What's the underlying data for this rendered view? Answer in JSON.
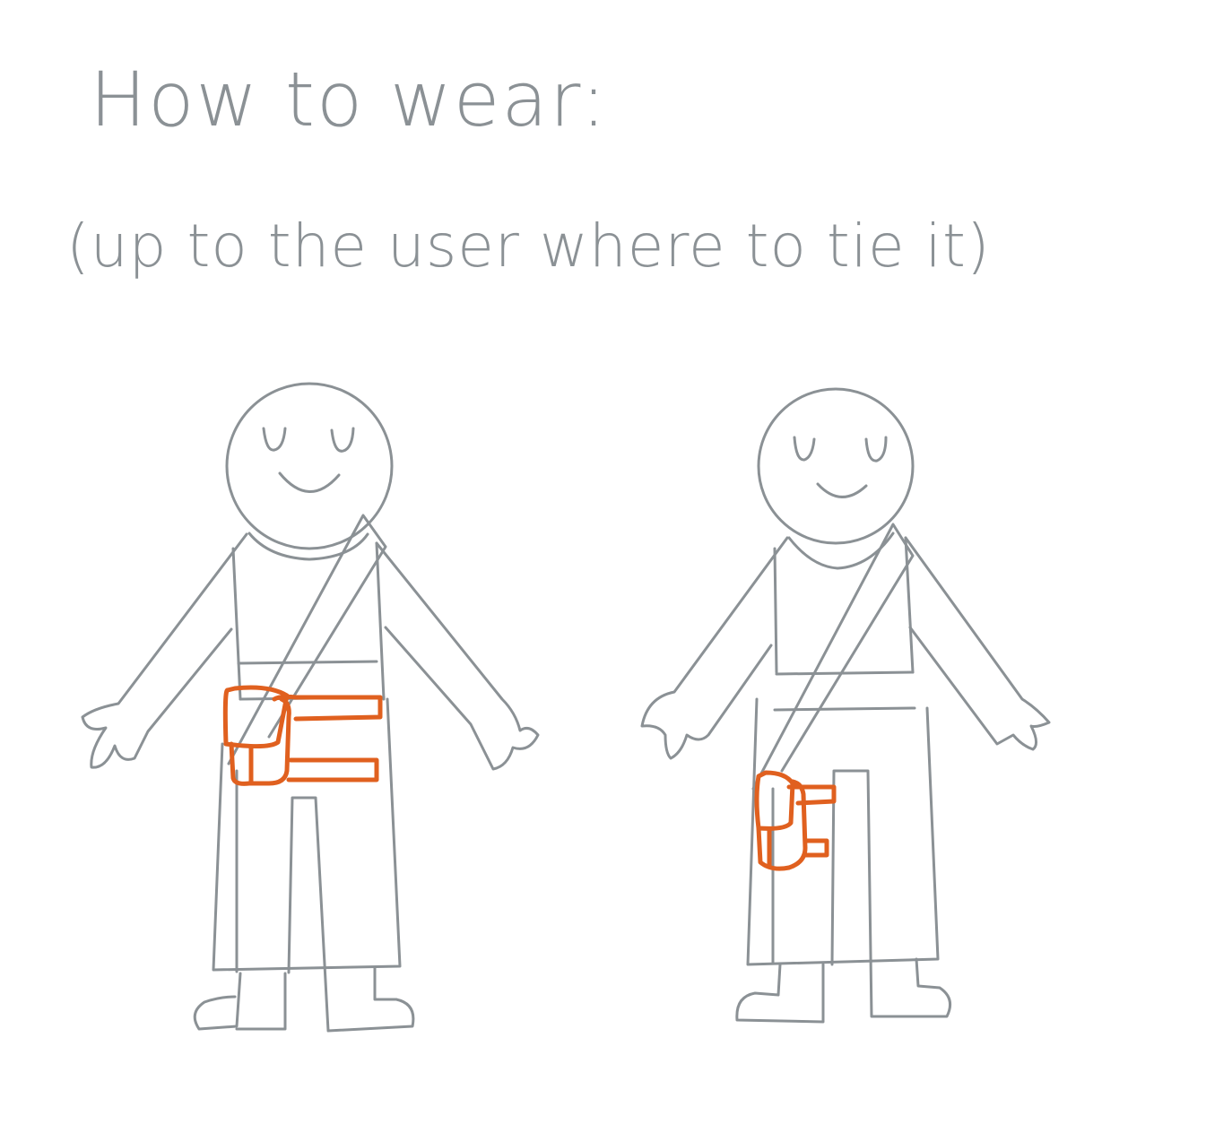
{
  "heading": "How to wear:",
  "note": "(up to the user where to tie it)",
  "colors": {
    "ink": "#8b9195",
    "bag": "#e0601f",
    "background": "#ffffff"
  },
  "figures": [
    {
      "name": "figure-left",
      "bag_position": "front waist"
    },
    {
      "name": "figure-right",
      "bag_position": "side hip"
    }
  ]
}
